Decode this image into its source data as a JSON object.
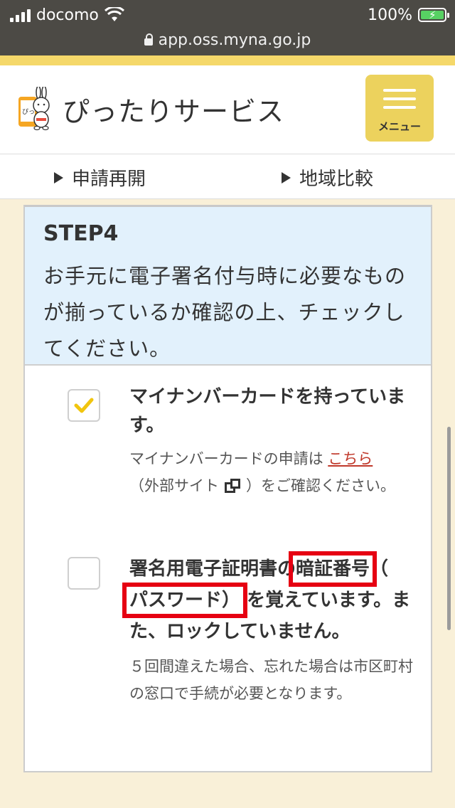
{
  "status_bar": {
    "carrier": "docomo",
    "battery_percent": "100%",
    "url": "app.oss.myna.go.jp"
  },
  "header": {
    "site_title": "ぴったりサービス",
    "menu_label": "メニュー"
  },
  "subnav": {
    "items": [
      {
        "label": "申請再開"
      },
      {
        "label": "地域比較"
      }
    ]
  },
  "step": {
    "title": "STEP4",
    "description": "お手元に電子署名付与時に必要なものが揃っているか確認の上、チェックしてください。"
  },
  "checklist": [
    {
      "checked": true,
      "title": "マイナンバーカードを持っています。",
      "note_prefix": "マイナンバーカードの申請は",
      "link_text": "こちら",
      "note_mid": "（外部サイト",
      "note_suffix": "）をご確認ください。"
    },
    {
      "checked": false,
      "title_part1": "署名用電子証明書の",
      "title_highlight1": "暗証番号",
      "title_part2": "（",
      "title_highlight2": "パスワード）",
      "title_part3": "を覚えています。また、ロックしていません。",
      "note": "５回間違えた場合、忘れた場合は市区町村の窓口で手続が必要となります。"
    }
  ],
  "colors": {
    "accent_yellow": "#ecd25d",
    "check_yellow": "#f1c50e",
    "highlight_red": "#e60012",
    "link_red": "#c0392b",
    "step_bg": "#e2f1fc"
  }
}
